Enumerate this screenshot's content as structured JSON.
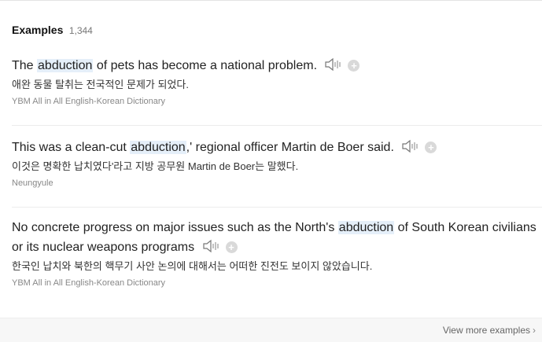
{
  "header": {
    "title": "Examples",
    "count": "1,344"
  },
  "examples": [
    {
      "en_before": "The ",
      "highlight": "abduction",
      "en_after": " of pets has become a national problem.",
      "ko": "애완 동물 탈취는 전국적인 문제가 되었다.",
      "source": "YBM All in All English-Korean Dictionary"
    },
    {
      "en_before": "This was a clean-cut ",
      "highlight": "abduction",
      "en_after": ",' regional officer Martin de Boer said.",
      "ko_before": "이것은 명확한 납치였다'라고 지방 공무원 ",
      "ko_name": "Martin de Boer",
      "ko_after": "는 말했다.",
      "source": "Neungyule"
    },
    {
      "en_before": "No concrete progress on major issues such as the North's ",
      "highlight": "abduction",
      "en_after": " of South Korean civilians or its nuclear weapons programs",
      "ko": "한국인 납치와 북한의 핵무기 사안 논의에 대해서는 어떠한 진전도 보이지 않았습니다.",
      "source": "YBM All in All English-Korean Dictionary"
    }
  ],
  "footer": {
    "more_label": "View more examples",
    "chevron": "›"
  },
  "icons": {
    "speaker": "speaker-icon",
    "add": "add-icon"
  },
  "colors": {
    "highlight": "#e5eff9",
    "muted": "#888888"
  }
}
